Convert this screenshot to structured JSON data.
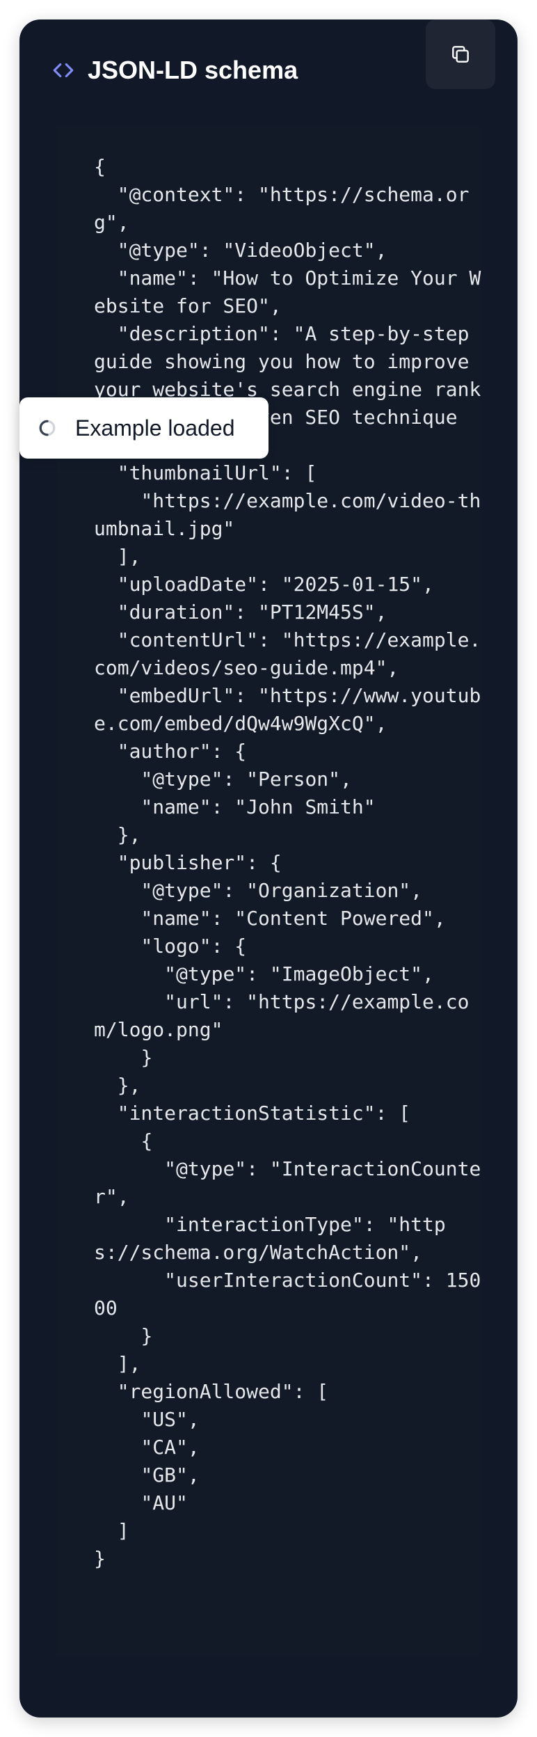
{
  "header": {
    "icon": "code-brackets-icon",
    "title": "JSON-LD schema",
    "copy_icon": "copy-icon",
    "accent_color": "#818cf8"
  },
  "code": {
    "text": "{\n  \"@context\": \"https://schema.org\",\n  \"@type\": \"VideoObject\",\n  \"name\": \"How to Optimize Your Website for SEO\",\n  \"description\": \"A step-by-step guide showing you how to improve your website's search engine rankings using proven SEO techniques.\",\n  \"thumbnailUrl\": [\n    \"https://example.com/video-thumbnail.jpg\"\n  ],\n  \"uploadDate\": \"2025-01-15\",\n  \"duration\": \"PT12M45S\",\n  \"contentUrl\": \"https://example.com/videos/seo-guide.mp4\",\n  \"embedUrl\": \"https://www.youtube.com/embed/dQw4w9WgXcQ\",\n  \"author\": {\n    \"@type\": \"Person\",\n    \"name\": \"John Smith\"\n  },\n  \"publisher\": {\n    \"@type\": \"Organization\",\n    \"name\": \"Content Powered\",\n    \"logo\": {\n      \"@type\": \"ImageObject\",\n      \"url\": \"https://example.com/logo.png\"\n    }\n  },\n  \"interactionStatistic\": [\n    {\n      \"@type\": \"InteractionCounter\",\n      \"interactionType\": \"https://schema.org/WatchAction\",\n      \"userInteractionCount\": 15000\n    }\n  ],\n  \"regionAllowed\": [\n    \"US\",\n    \"CA\",\n    \"GB\",\n    \"AU\"\n  ]\n}"
  },
  "toast": {
    "icon": "spinner-icon",
    "text": "Example loaded"
  }
}
